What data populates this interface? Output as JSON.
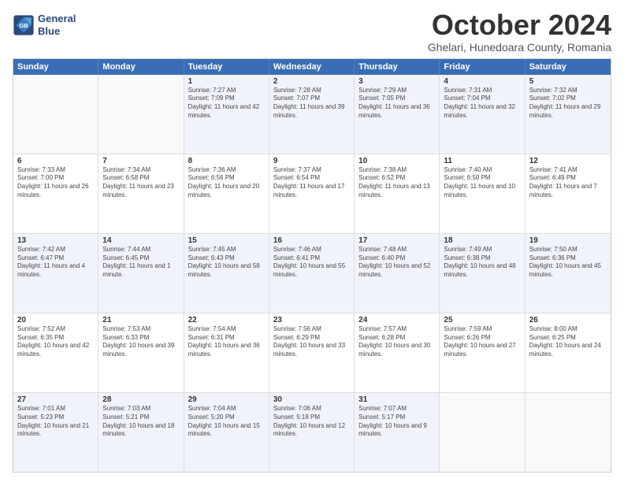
{
  "logo": {
    "line1": "General",
    "line2": "Blue"
  },
  "title": "October 2024",
  "subtitle": "Ghelari, Hunedoara County, Romania",
  "header_days": [
    "Sunday",
    "Monday",
    "Tuesday",
    "Wednesday",
    "Thursday",
    "Friday",
    "Saturday"
  ],
  "rows": [
    [
      {
        "day": "",
        "sunrise": "",
        "sunset": "",
        "daylight": ""
      },
      {
        "day": "",
        "sunrise": "",
        "sunset": "",
        "daylight": ""
      },
      {
        "day": "1",
        "sunrise": "Sunrise: 7:27 AM",
        "sunset": "Sunset: 7:09 PM",
        "daylight": "Daylight: 11 hours and 42 minutes."
      },
      {
        "day": "2",
        "sunrise": "Sunrise: 7:28 AM",
        "sunset": "Sunset: 7:07 PM",
        "daylight": "Daylight: 11 hours and 39 minutes."
      },
      {
        "day": "3",
        "sunrise": "Sunrise: 7:29 AM",
        "sunset": "Sunset: 7:05 PM",
        "daylight": "Daylight: 11 hours and 36 minutes."
      },
      {
        "day": "4",
        "sunrise": "Sunrise: 7:31 AM",
        "sunset": "Sunset: 7:04 PM",
        "daylight": "Daylight: 11 hours and 32 minutes."
      },
      {
        "day": "5",
        "sunrise": "Sunrise: 7:32 AM",
        "sunset": "Sunset: 7:02 PM",
        "daylight": "Daylight: 11 hours and 29 minutes."
      }
    ],
    [
      {
        "day": "6",
        "sunrise": "Sunrise: 7:33 AM",
        "sunset": "Sunset: 7:00 PM",
        "daylight": "Daylight: 11 hours and 26 minutes."
      },
      {
        "day": "7",
        "sunrise": "Sunrise: 7:34 AM",
        "sunset": "Sunset: 6:58 PM",
        "daylight": "Daylight: 11 hours and 23 minutes."
      },
      {
        "day": "8",
        "sunrise": "Sunrise: 7:36 AM",
        "sunset": "Sunset: 6:56 PM",
        "daylight": "Daylight: 11 hours and 20 minutes."
      },
      {
        "day": "9",
        "sunrise": "Sunrise: 7:37 AM",
        "sunset": "Sunset: 6:54 PM",
        "daylight": "Daylight: 11 hours and 17 minutes."
      },
      {
        "day": "10",
        "sunrise": "Sunrise: 7:38 AM",
        "sunset": "Sunset: 6:52 PM",
        "daylight": "Daylight: 11 hours and 13 minutes."
      },
      {
        "day": "11",
        "sunrise": "Sunrise: 7:40 AM",
        "sunset": "Sunset: 6:50 PM",
        "daylight": "Daylight: 11 hours and 10 minutes."
      },
      {
        "day": "12",
        "sunrise": "Sunrise: 7:41 AM",
        "sunset": "Sunset: 6:49 PM",
        "daylight": "Daylight: 11 hours and 7 minutes."
      }
    ],
    [
      {
        "day": "13",
        "sunrise": "Sunrise: 7:42 AM",
        "sunset": "Sunset: 6:47 PM",
        "daylight": "Daylight: 11 hours and 4 minutes."
      },
      {
        "day": "14",
        "sunrise": "Sunrise: 7:44 AM",
        "sunset": "Sunset: 6:45 PM",
        "daylight": "Daylight: 11 hours and 1 minute."
      },
      {
        "day": "15",
        "sunrise": "Sunrise: 7:45 AM",
        "sunset": "Sunset: 6:43 PM",
        "daylight": "Daylight: 10 hours and 58 minutes."
      },
      {
        "day": "16",
        "sunrise": "Sunrise: 7:46 AM",
        "sunset": "Sunset: 6:41 PM",
        "daylight": "Daylight: 10 hours and 55 minutes."
      },
      {
        "day": "17",
        "sunrise": "Sunrise: 7:48 AM",
        "sunset": "Sunset: 6:40 PM",
        "daylight": "Daylight: 10 hours and 52 minutes."
      },
      {
        "day": "18",
        "sunrise": "Sunrise: 7:49 AM",
        "sunset": "Sunset: 6:38 PM",
        "daylight": "Daylight: 10 hours and 48 minutes."
      },
      {
        "day": "19",
        "sunrise": "Sunrise: 7:50 AM",
        "sunset": "Sunset: 6:36 PM",
        "daylight": "Daylight: 10 hours and 45 minutes."
      }
    ],
    [
      {
        "day": "20",
        "sunrise": "Sunrise: 7:52 AM",
        "sunset": "Sunset: 6:35 PM",
        "daylight": "Daylight: 10 hours and 42 minutes."
      },
      {
        "day": "21",
        "sunrise": "Sunrise: 7:53 AM",
        "sunset": "Sunset: 6:33 PM",
        "daylight": "Daylight: 10 hours and 39 minutes."
      },
      {
        "day": "22",
        "sunrise": "Sunrise: 7:54 AM",
        "sunset": "Sunset: 6:31 PM",
        "daylight": "Daylight: 10 hours and 36 minutes."
      },
      {
        "day": "23",
        "sunrise": "Sunrise: 7:56 AM",
        "sunset": "Sunset: 6:29 PM",
        "daylight": "Daylight: 10 hours and 33 minutes."
      },
      {
        "day": "24",
        "sunrise": "Sunrise: 7:57 AM",
        "sunset": "Sunset: 6:28 PM",
        "daylight": "Daylight: 10 hours and 30 minutes."
      },
      {
        "day": "25",
        "sunrise": "Sunrise: 7:59 AM",
        "sunset": "Sunset: 6:26 PM",
        "daylight": "Daylight: 10 hours and 27 minutes."
      },
      {
        "day": "26",
        "sunrise": "Sunrise: 8:00 AM",
        "sunset": "Sunset: 6:25 PM",
        "daylight": "Daylight: 10 hours and 24 minutes."
      }
    ],
    [
      {
        "day": "27",
        "sunrise": "Sunrise: 7:01 AM",
        "sunset": "Sunset: 5:23 PM",
        "daylight": "Daylight: 10 hours and 21 minutes."
      },
      {
        "day": "28",
        "sunrise": "Sunrise: 7:03 AM",
        "sunset": "Sunset: 5:21 PM",
        "daylight": "Daylight: 10 hours and 18 minutes."
      },
      {
        "day": "29",
        "sunrise": "Sunrise: 7:04 AM",
        "sunset": "Sunset: 5:20 PM",
        "daylight": "Daylight: 10 hours and 15 minutes."
      },
      {
        "day": "30",
        "sunrise": "Sunrise: 7:06 AM",
        "sunset": "Sunset: 5:18 PM",
        "daylight": "Daylight: 10 hours and 12 minutes."
      },
      {
        "day": "31",
        "sunrise": "Sunrise: 7:07 AM",
        "sunset": "Sunset: 5:17 PM",
        "daylight": "Daylight: 10 hours and 9 minutes."
      },
      {
        "day": "",
        "sunrise": "",
        "sunset": "",
        "daylight": ""
      },
      {
        "day": "",
        "sunrise": "",
        "sunset": "",
        "daylight": ""
      }
    ]
  ],
  "row_styles": [
    "alt",
    "normal",
    "alt",
    "normal",
    "alt"
  ]
}
